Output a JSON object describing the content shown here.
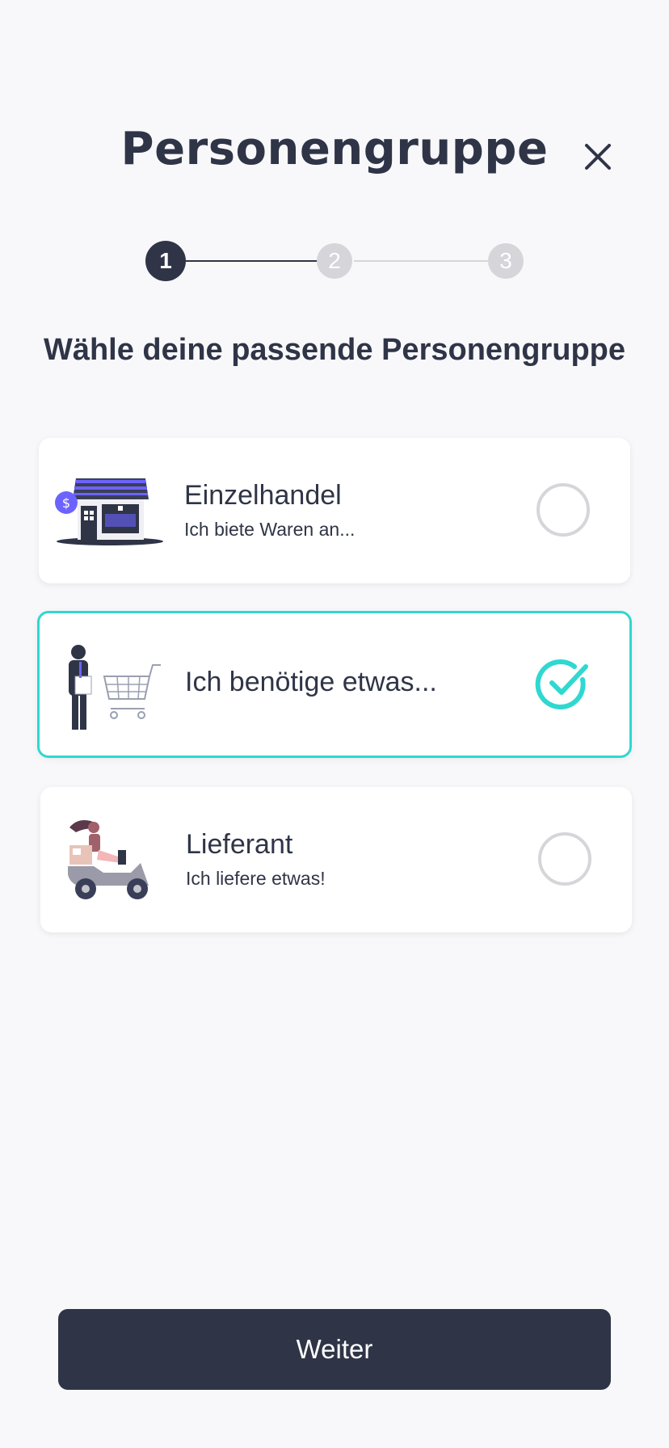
{
  "header": {
    "title": "Personengruppe"
  },
  "stepper": {
    "steps": [
      "1",
      "2",
      "3"
    ],
    "current_step": 1
  },
  "subtitle": "Wähle deine passende Personengruppe",
  "options": [
    {
      "title": "Einzelhandel",
      "description": "Ich biete Waren an...",
      "selected": false,
      "illustration": "shop-illustration"
    },
    {
      "title": "Ich benötige etwas...",
      "description": "",
      "selected": true,
      "illustration": "shopping-cart-illustration"
    },
    {
      "title": "Lieferant",
      "description": "Ich liefere etwas!",
      "selected": false,
      "illustration": "scooter-delivery-illustration"
    }
  ],
  "footer": {
    "next_label": "Weiter"
  },
  "colors": {
    "primary": "#2f3547",
    "accent": "#2fd8d0",
    "inactive": "#d5d5da",
    "background": "#f8f8fb",
    "illustration_purple": "#6c63ff"
  }
}
